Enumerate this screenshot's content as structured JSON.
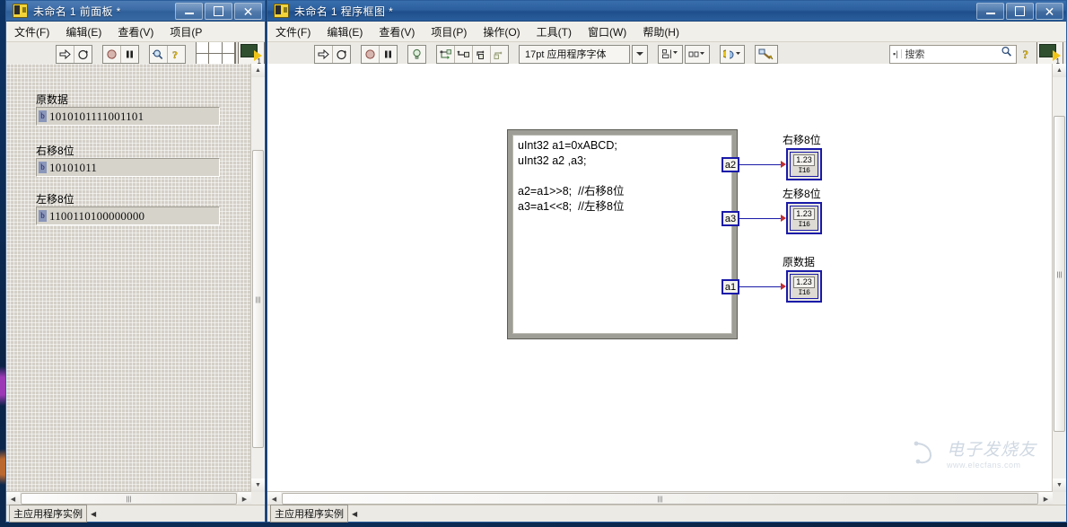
{
  "front_panel": {
    "title": "未命名 1 前面板 *",
    "icon_name": "labview-vi-icon",
    "window_buttons": {
      "minimize": "—",
      "maximize": "▢",
      "close": "✕"
    },
    "menu": [
      {
        "label": "文件(F)"
      },
      {
        "label": "编辑(E)"
      },
      {
        "label": "查看(V)"
      },
      {
        "label": "项目(P"
      }
    ],
    "toolbar": [
      {
        "name": "run-button",
        "glyph": "⇨"
      },
      {
        "name": "run-continuously-button",
        "glyph": "⟳"
      },
      {
        "name": "abort-execution-button",
        "glyph": "⬤"
      },
      {
        "name": "pause-button",
        "glyph": "❚❚"
      },
      {
        "name": "zoom-tool-button",
        "glyph": "🔍"
      },
      {
        "name": "help-button",
        "glyph": "?"
      }
    ],
    "controls": [
      {
        "label": "原数据",
        "radix": "b",
        "value": "1010101111001101"
      },
      {
        "label": "右移8位",
        "radix": "b",
        "value": "10101011"
      },
      {
        "label": "左移8位",
        "radix": "b",
        "value": "1100110100000000"
      }
    ],
    "statusbar": {
      "context_label": "主应用程序实例",
      "nav_arrow": "◀"
    },
    "scrollbars": {
      "up": "▲",
      "down": "▼",
      "left": "◀",
      "right": "▶",
      "grip": "|||"
    }
  },
  "block_diagram": {
    "title": "未命名 1 程序框图 *",
    "icon_name": "labview-vi-icon",
    "window_buttons": {
      "minimize": "—",
      "maximize": "▢",
      "close": "✕"
    },
    "menu": [
      {
        "label": "文件(F)"
      },
      {
        "label": "编辑(E)"
      },
      {
        "label": "查看(V)"
      },
      {
        "label": "项目(P)"
      },
      {
        "label": "操作(O)"
      },
      {
        "label": "工具(T)"
      },
      {
        "label": "窗口(W)"
      },
      {
        "label": "帮助(H)"
      }
    ],
    "toolbar": {
      "run": "⇨",
      "run_continuously": "⟳",
      "abort": "⬤",
      "pause": "❚❚",
      "highlight_execution": "💡",
      "retain_wire_values": "⇲",
      "step_into": "↳",
      "step_over": "⤵",
      "step_out": "⤴",
      "font_selector": "17pt 应用程序字体",
      "font_arrow": "▼",
      "align_objects": "⊞",
      "distribute_objects": "⊟",
      "resize_objects": "⊡",
      "reorder": "⧉",
      "clean_up_diagram": "🖌",
      "dropdown_arrow": "▼"
    },
    "search": {
      "placeholder": "搜索",
      "icon": "magnifier-icon",
      "left_glyph": "▪|"
    },
    "help_button": "?",
    "vi_icon_number": "1",
    "code_node": {
      "lines": [
        "uInt32 a1=0xABCD;",
        "uInt32 a2 ,a3;",
        "",
        "a2=a1>>8;  //右移8位",
        "a3=a1<<8;  //左移8位"
      ],
      "terminals": [
        {
          "name": "a2"
        },
        {
          "name": "a3"
        },
        {
          "name": "a1"
        }
      ]
    },
    "indicators": [
      {
        "label": "右移8位",
        "display": "1.23",
        "type": "I16"
      },
      {
        "label": "左移8位",
        "display": "1.23",
        "type": "I16"
      },
      {
        "label": "原数据",
        "display": "1.23",
        "type": "I16"
      }
    ],
    "statusbar": {
      "context_label": "主应用程序实例",
      "nav_arrow": "◀"
    },
    "scrollbars": {
      "up": "▲",
      "down": "▼",
      "left": "◀",
      "right": "▶",
      "grip": "|||"
    }
  },
  "watermark": {
    "text": "电子发烧友",
    "url": "www.elecfans.com"
  }
}
